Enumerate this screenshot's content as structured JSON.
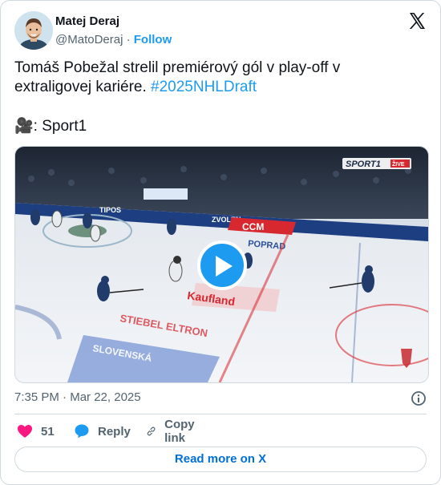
{
  "author": {
    "name": "Matej Deraj",
    "handle": "@MatoDeraj",
    "separator": "·",
    "follow_label": "Follow"
  },
  "tweet": {
    "text": "Tomáš Pobežal strelil premiérový gól v play-off v extraligovej kariére.",
    "hashtag": "#2025NHLDraft",
    "credit_emoji": "🎥",
    "credit_text": ": Sport1"
  },
  "media": {
    "broadcaster": "SPORT1",
    "live_badge": "ŽIVE",
    "ad_texts": [
      "CCM",
      "POPRAD",
      "Kaufland",
      "STIEBEL ELTRON",
      "SLOVENSKÁ"
    ]
  },
  "meta": {
    "time": "7:35 PM",
    "separator": "·",
    "date": "Mar 22, 2025"
  },
  "actions": {
    "likes": "51",
    "reply_label": "Reply",
    "copy_label": "Copy link"
  },
  "footer": {
    "read_more_label": "Read more on X"
  },
  "colors": {
    "accent": "#1d9bf0",
    "like": "#f91880",
    "muted": "#536471",
    "link_button": "#006fd6"
  }
}
